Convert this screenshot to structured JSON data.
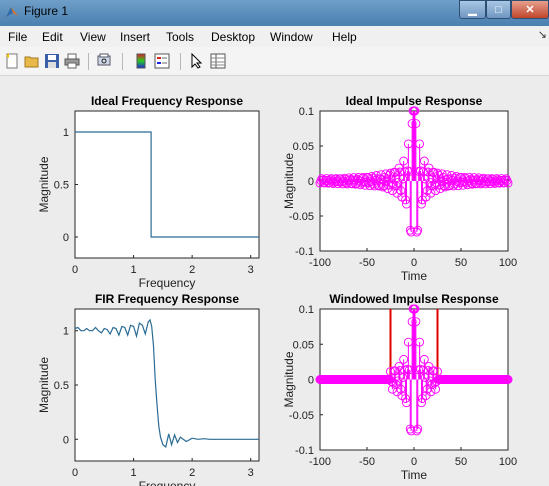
{
  "window": {
    "title": "Figure 1"
  },
  "menu": {
    "items": [
      "File",
      "Edit",
      "View",
      "Insert",
      "Tools",
      "Desktop",
      "Window",
      "Help"
    ]
  },
  "toolbar": {
    "icons": [
      "new-figure-icon",
      "open-file-icon",
      "save-icon",
      "print-icon",
      "print-preview-icon",
      "colorbar-icon",
      "legend-icon",
      "edit-plot-icon",
      "property-inspector-icon"
    ]
  },
  "colors": {
    "line": "#2a6b94",
    "stem": "#ff00ff",
    "window_line": "#e00000"
  },
  "chart_data": [
    {
      "type": "line",
      "title": "Ideal Frequency Response",
      "xlabel": "Frequency",
      "ylabel": "Magnitude",
      "xlim": [
        0,
        3.14159
      ],
      "ylim": [
        -0.2,
        1.2
      ],
      "xticks": [
        0,
        1,
        2,
        3
      ],
      "yticks": [
        0,
        0.5,
        1
      ],
      "ytick_labels": [
        "0",
        "0.5",
        "1"
      ],
      "x": [
        0,
        1.3,
        1.3,
        3.14159
      ],
      "y": [
        1,
        1,
        0,
        0
      ]
    },
    {
      "type": "stem",
      "title": "Ideal Impulse Response",
      "xlabel": "Time",
      "ylabel": "Magnitude",
      "xlim": [
        -100,
        100
      ],
      "ylim": [
        -0.1,
        0.1
      ],
      "xticks": [
        -100,
        -50,
        0,
        50,
        100
      ],
      "yticks": [
        -0.1,
        -0.05,
        0,
        0.05,
        0.1
      ],
      "ytick_labels": [
        "-0.1",
        "-0.05",
        "0",
        "0.05",
        "0.1"
      ],
      "cutoff": 1.3,
      "n_range": [
        -100,
        100
      ]
    },
    {
      "type": "line",
      "title": "FIR Frequency Response",
      "xlabel": "Frequency",
      "ylabel": "Magnitude",
      "xlim": [
        0,
        3.14159
      ],
      "ylim": [
        -0.2,
        1.2
      ],
      "xticks": [
        0,
        1,
        2,
        3
      ],
      "yticks": [
        0,
        0.5,
        1
      ],
      "ytick_labels": [
        "0",
        "0.5",
        "1"
      ],
      "x": [
        0,
        0.05,
        0.1,
        0.15,
        0.2,
        0.25,
        0.3,
        0.35,
        0.4,
        0.45,
        0.5,
        0.55,
        0.6,
        0.65,
        0.7,
        0.75,
        0.8,
        0.85,
        0.9,
        0.95,
        1.0,
        1.05,
        1.1,
        1.15,
        1.2,
        1.25,
        1.28,
        1.31,
        1.34,
        1.37,
        1.4,
        1.43,
        1.46,
        1.5,
        1.55,
        1.6,
        1.65,
        1.7,
        1.75,
        1.8,
        1.9,
        2.0,
        2.1,
        2.2,
        2.3,
        2.4,
        2.5,
        2.6,
        2.7,
        2.8,
        2.9,
        3.0,
        3.14159
      ],
      "y": [
        1.02,
        1.03,
        1.0,
        1.0,
        1.02,
        1.0,
        1.0,
        1.03,
        1.0,
        0.98,
        1.02,
        1.01,
        0.97,
        1.03,
        1.02,
        0.96,
        1.04,
        1.03,
        0.96,
        1.05,
        1.04,
        0.95,
        1.07,
        1.05,
        0.97,
        1.08,
        1.1,
        1.04,
        0.86,
        0.55,
        0.32,
        0.12,
        0.02,
        -0.05,
        -0.07,
        0.05,
        -0.05,
        0.04,
        -0.03,
        0.02,
        -0.02,
        0.01,
        0.0,
        0.005,
        0.0,
        0.0,
        0.0,
        0.0,
        0.0,
        0.0,
        0.0,
        0.0,
        0.0
      ]
    },
    {
      "type": "stem",
      "title": "Windowed Impulse Response",
      "xlabel": "Time",
      "ylabel": "Magnitude",
      "xlim": [
        -100,
        100
      ],
      "ylim": [
        -0.1,
        0.1
      ],
      "xticks": [
        -100,
        -50,
        0,
        50,
        100
      ],
      "yticks": [
        -0.1,
        -0.05,
        0,
        0.05,
        0.1
      ],
      "ytick_labels": [
        "-0.1",
        "-0.05",
        "0",
        "0.05",
        "0.1"
      ],
      "cutoff": 1.3,
      "n_range": [
        -100,
        100
      ],
      "window_half_width": 25
    }
  ]
}
